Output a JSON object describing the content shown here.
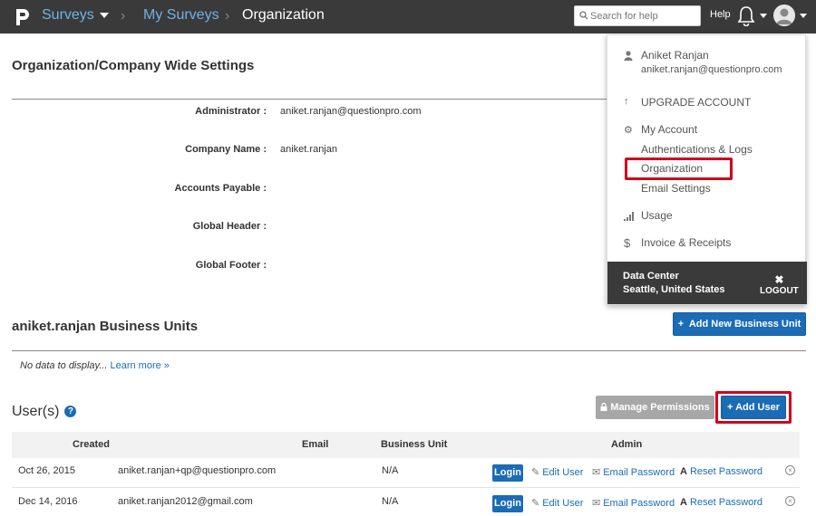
{
  "topbar": {
    "brand": "Surveys",
    "breadcrumb_link": "My Surveys",
    "breadcrumb_current": "Organization",
    "search_placeholder": "Search for help",
    "help_label": "Help"
  },
  "settings": {
    "title": "Organization/Company Wide Settings",
    "fields": [
      {
        "label": "Administrator :",
        "value": "aniket.ranjan@questionpro.com"
      },
      {
        "label": "Company Name :",
        "value": "aniket.ranjan"
      },
      {
        "label": "Accounts Payable :",
        "value": ""
      },
      {
        "label": "Global Header :",
        "value": ""
      },
      {
        "label": "Global Footer :",
        "value": ""
      }
    ]
  },
  "business_units": {
    "title": "aniket.ranjan Business Units",
    "add_button": "Add New Business Unit",
    "no_data": "No data to display...",
    "learn_more": "Learn more »"
  },
  "users": {
    "title": "User(s)",
    "manage_button": "Manage Permissions",
    "add_button": "Add User",
    "columns": [
      "Created",
      "Email",
      "Business Unit",
      "Admin"
    ],
    "rows": [
      {
        "created": "Oct 26, 2015",
        "email": "aniket.ranjan+qp@questionpro.com",
        "unit": "N/A"
      },
      {
        "created": "Dec 14, 2016",
        "email": "aniket.ranjan2012@gmail.com",
        "unit": "N/A"
      }
    ],
    "actions": {
      "login": "Login",
      "edit": "Edit User",
      "email_password": "Email Password",
      "reset_password": "Reset Password"
    }
  },
  "dropdown": {
    "user_name": "Aniket Ranjan",
    "user_email": "aniket.ranjan@questionpro.com",
    "upgrade": "UPGRADE ACCOUNT",
    "my_account": "My Account",
    "auth_logs": "Authentications & Logs",
    "organization": "Organization",
    "email_settings": "Email Settings",
    "usage": "Usage",
    "invoice": "Invoice & Receipts",
    "data_center_label": "Data Center",
    "data_center_value": "Seattle, United States",
    "logout": "LOGOUT"
  },
  "colors": {
    "accent": "#1b6cb5",
    "topbar": "#3a3a3a",
    "highlight": "#d0021b"
  }
}
